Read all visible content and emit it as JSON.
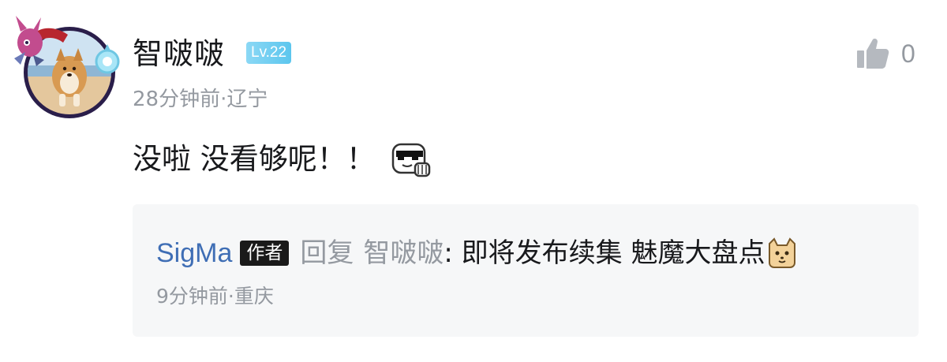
{
  "comment": {
    "username": "智啵啵",
    "level": "Lv.22",
    "meta": "28分钟前·辽宁",
    "text": "没啦 没看够呢！！",
    "emoji": "sunglasses-emoji",
    "like_count": "0"
  },
  "reply": {
    "author": "SigMa",
    "author_tag": "作者",
    "prefix": "回复",
    "target": "智啵啵",
    "text": ": 即将发布续集 魅魔大盘点",
    "emoji": "cat-face-emoji",
    "meta": "9分钟前·重庆"
  },
  "colors": {
    "level_badge": "#5cc6ee",
    "author_link": "#3f6eb5",
    "muted_text": "#9499a0",
    "reply_bg": "#f6f7f8"
  }
}
